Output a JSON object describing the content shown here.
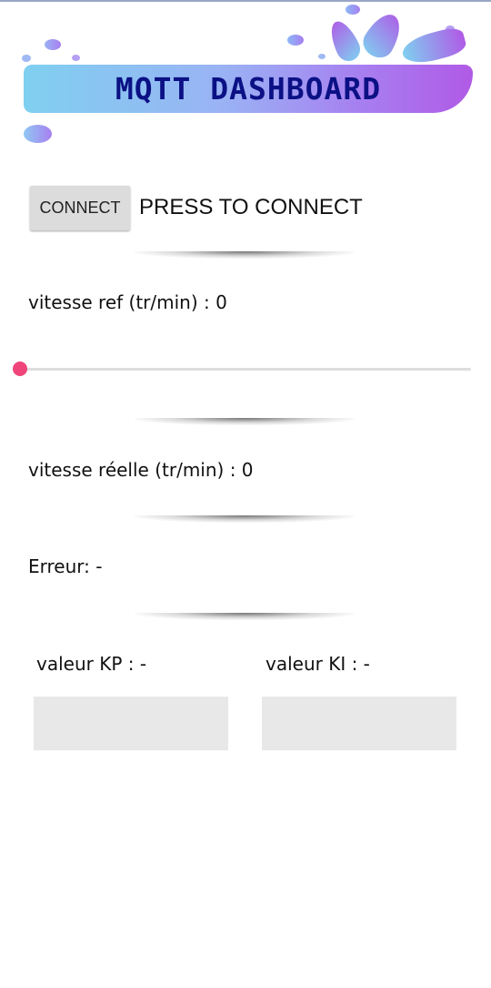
{
  "header": {
    "title": "MQTT DASHBOARD"
  },
  "connection": {
    "button_label": "CONNECT",
    "status_text": "PRESS TO CONNECT"
  },
  "reference_speed": {
    "label": "vitesse ref (tr/min) : 0",
    "slider_value": 0
  },
  "actual_speed": {
    "label": "vitesse réelle (tr/min) : 0"
  },
  "error": {
    "label": "Erreur: -"
  },
  "gains": {
    "kp_label": "valeur KP : -",
    "ki_label": "valeur KI : -",
    "kp_value": "",
    "ki_value": ""
  },
  "colors": {
    "accent": "#f0457a",
    "title_text": "#0b1185",
    "banner_start": "#7fd0f0",
    "banner_end": "#b05ae6"
  }
}
